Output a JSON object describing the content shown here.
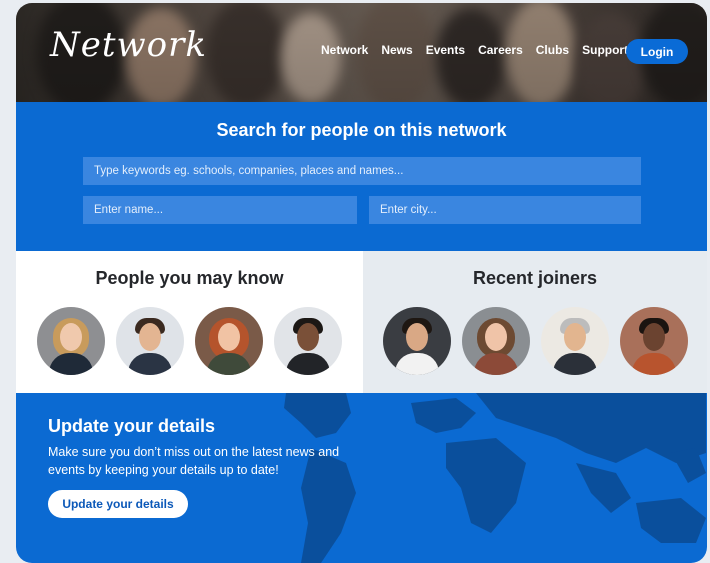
{
  "header": {
    "brand": "Network",
    "nav": [
      "Network",
      "News",
      "Events",
      "Careers",
      "Clubs",
      "Support"
    ],
    "login_label": "Login"
  },
  "search": {
    "title": "Search for people on this network",
    "keywords_placeholder": "Type keywords eg. schools, companies, places and names...",
    "name_placeholder": "Enter name...",
    "city_placeholder": "Enter city..."
  },
  "people_you_may_know": {
    "title": "People you may know"
  },
  "recent_joiners": {
    "title": "Recent joiners"
  },
  "update": {
    "title": "Update your details",
    "text": "Make sure you don’t miss out on the latest news and events by keeping your details up to date!",
    "button_label": "Update your details"
  },
  "colors": {
    "primary_blue": "#0b6ad2",
    "login_blue": "#0a6bd6",
    "map_land": "#0a4f9c",
    "panel_grey": "#e6ebf0"
  }
}
